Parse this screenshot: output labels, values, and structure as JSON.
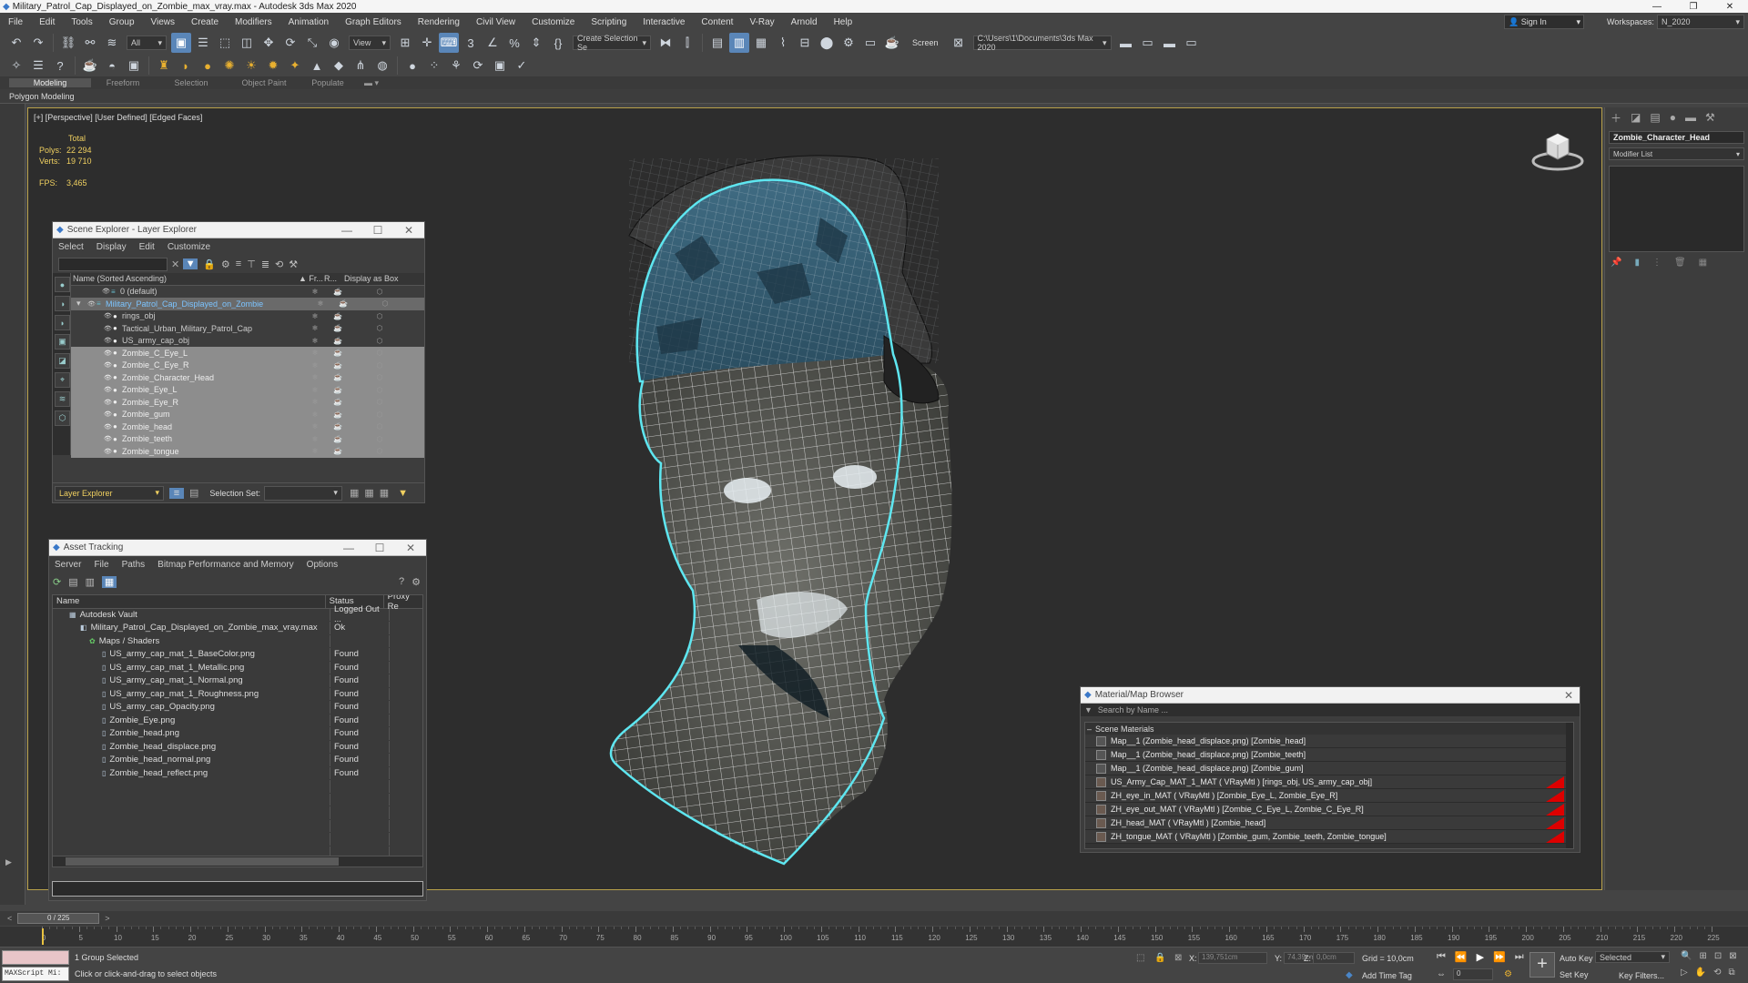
{
  "title": "Military_Patrol_Cap_Displayed_on_Zombie_max_vray.max - Autodesk 3ds Max 2020",
  "menubar": [
    "File",
    "Edit",
    "Tools",
    "Group",
    "Views",
    "Create",
    "Modifiers",
    "Animation",
    "Graph Editors",
    "Rendering",
    "Civil View",
    "Customize",
    "Scripting",
    "Interactive",
    "Content",
    "V-Ray",
    "Arnold",
    "Help"
  ],
  "signin": "Sign In",
  "workspaces_label": "Workspaces:",
  "workspace_value": "N_2020",
  "toolbar": {
    "filter": "All",
    "view": "View",
    "selset": "Create Selection Se",
    "screen": "Screen",
    "path": "C:\\Users\\1\\Documents\\3ds Max 2020"
  },
  "ribbon_tabs": [
    "Modeling",
    "Freeform",
    "Selection",
    "Object Paint",
    "Populate"
  ],
  "ribbon_sub": "Polygon Modeling",
  "viewport": {
    "label": "[+] [Perspective] [User Defined] [Edged Faces]",
    "total": "Total",
    "polys_label": "Polys:",
    "polys": "22 294",
    "verts_label": "Verts:",
    "verts": "19 710",
    "fps_label": "FPS:",
    "fps": "3,465"
  },
  "scene_explorer": {
    "title": "Scene Explorer - Layer Explorer",
    "menu": [
      "Select",
      "Display",
      "Edit",
      "Customize"
    ],
    "col_name": "Name (Sorted Ascending)",
    "col_fr": "▲ Fr...",
    "col_r": "R...",
    "col_box": "Display as Box",
    "rows": [
      "0 (default)",
      "Military_Patrol_Cap_Displayed_on_Zombie",
      "rings_obj",
      "Tactical_Urban_Military_Patrol_Cap",
      "US_army_cap_obj",
      "Zombie_C_Eye_L",
      "Zombie_C_Eye_R",
      "Zombie_Character_Head",
      "Zombie_Eye_L",
      "Zombie_Eye_R",
      "Zombie_gum",
      "Zombie_head",
      "Zombie_teeth",
      "Zombie_tongue"
    ],
    "footer_mode": "Layer Explorer",
    "selection_set": "Selection Set:"
  },
  "asset_tracking": {
    "title": "Asset Tracking",
    "menu": [
      "Server",
      "File",
      "Paths",
      "Bitmap Performance and Memory",
      "Options"
    ],
    "col_name": "Name",
    "col_status": "Status",
    "col_proxy": "Proxy Re",
    "rows": [
      {
        "name": "Autodesk Vault",
        "status": "Logged Out ..."
      },
      {
        "name": "Military_Patrol_Cap_Displayed_on_Zombie_max_vray.max",
        "status": "Ok"
      },
      {
        "name": "Maps / Shaders",
        "status": ""
      },
      {
        "name": "US_army_cap_mat_1_BaseColor.png",
        "status": "Found"
      },
      {
        "name": "US_army_cap_mat_1_Metallic.png",
        "status": "Found"
      },
      {
        "name": "US_army_cap_mat_1_Normal.png",
        "status": "Found"
      },
      {
        "name": "US_army_cap_mat_1_Roughness.png",
        "status": "Found"
      },
      {
        "name": "US_army_cap_Opacity.png",
        "status": "Found"
      },
      {
        "name": "Zombie_Eye.png",
        "status": "Found"
      },
      {
        "name": "Zombie_head.png",
        "status": "Found"
      },
      {
        "name": "Zombie_head_displace.png",
        "status": "Found"
      },
      {
        "name": "Zombie_head_normal.png",
        "status": "Found"
      },
      {
        "name": "Zombie_head_reflect.png",
        "status": "Found"
      }
    ]
  },
  "material_browser": {
    "title": "Material/Map Browser",
    "search": "Search by Name ...",
    "section": "Scene Materials",
    "rows": [
      "Map__1 (Zombie_head_displace.png) [Zombie_head]",
      "Map__1 (Zombie_head_displace.png) [Zombie_teeth]",
      "Map__1 (Zombie_head_displace.png) [Zombie_gum]",
      "US_Army_Cap_MAT_1_MAT ( VRayMtl ) [rings_obj, US_army_cap_obj]",
      "ZH_eye_in_MAT ( VRayMtl ) [Zombie_Eye_L, Zombie_Eye_R]",
      "ZH_eye_out_MAT ( VRayMtl ) [Zombie_C_Eye_L, Zombie_C_Eye_R]",
      "ZH_head_MAT ( VRayMtl ) [Zombie_head]",
      "ZH_tongue_MAT ( VRayMtl ) [Zombie_gum, Zombie_teeth, Zombie_tongue]"
    ]
  },
  "command_panel": {
    "object_name": "Zombie_Character_Head",
    "modifier_list": "Modifier List"
  },
  "timeline": {
    "frame": "0 / 225",
    "ticks": [
      "0",
      "5",
      "10",
      "15",
      "20",
      "25",
      "30",
      "35",
      "40",
      "45",
      "50",
      "55",
      "60",
      "65",
      "70",
      "75",
      "80",
      "85",
      "90",
      "95",
      "100",
      "105",
      "110",
      "115",
      "120",
      "125",
      "130",
      "135",
      "140",
      "145",
      "150",
      "155",
      "160",
      "165",
      "170",
      "175",
      "180",
      "185",
      "190",
      "195",
      "200",
      "205",
      "210",
      "215",
      "220",
      "225"
    ]
  },
  "status": {
    "maxscript": "MAXScript Mi:",
    "selected": "1 Group Selected",
    "hint": "Click or click-and-drag to select objects",
    "x_label": "X:",
    "x": "139,751cm",
    "y_label": "Y:",
    "y": "74,39cm",
    "z_label": "Z:",
    "z": "0,0cm",
    "grid": "Grid = 10,0cm",
    "add_time_tag": "Add Time Tag",
    "auto_key": "Auto Key",
    "selected_dd": "Selected",
    "set_key": "Set Key",
    "key_filters": "Key Filters...",
    "frame_field": "0"
  },
  "colors": {
    "accent": "#5a86b8",
    "selection_outline": "#5ee6f0",
    "viewport_bg": "#2d2d2d",
    "yellow_text": "#f0d060"
  }
}
